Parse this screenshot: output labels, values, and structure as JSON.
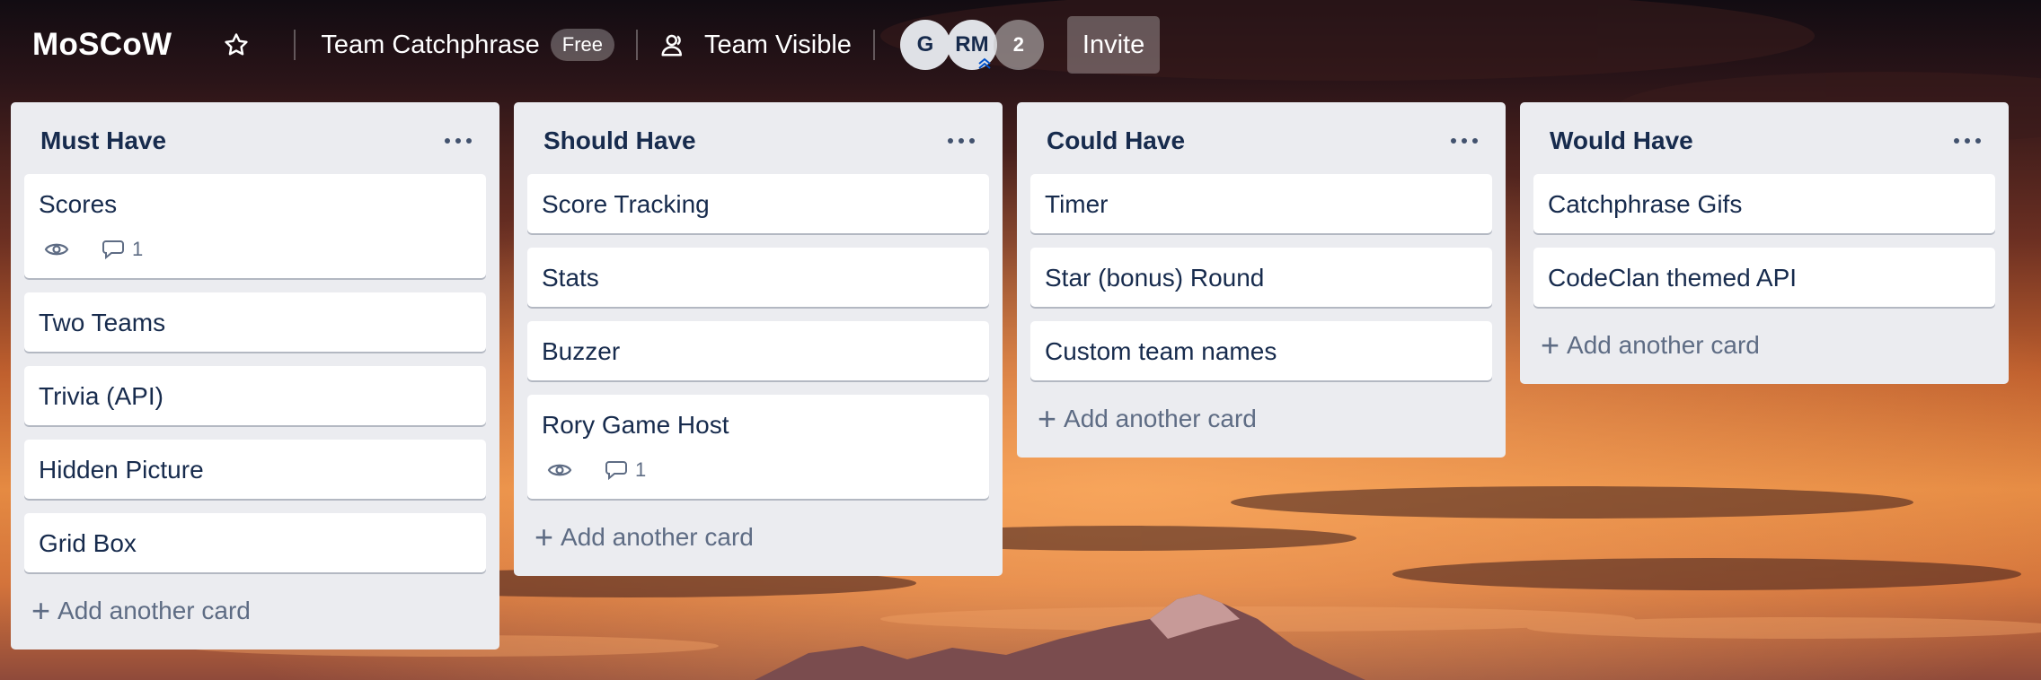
{
  "board": {
    "title": "MoSCoW",
    "team_name": "Team Catchphrase",
    "plan_badge": "Free",
    "visibility": "Team Visible",
    "members": [
      "G",
      "RM"
    ],
    "extra_members": "2",
    "invite_label": "Invite"
  },
  "lists": [
    {
      "title": "Must Have",
      "cards": [
        {
          "title": "Scores",
          "watch": true,
          "comments": "1"
        },
        {
          "title": "Two Teams"
        },
        {
          "title": "Trivia (API)"
        },
        {
          "title": "Hidden Picture"
        },
        {
          "title": "Grid Box"
        }
      ],
      "add_label": "Add another card"
    },
    {
      "title": "Should Have",
      "cards": [
        {
          "title": "Score Tracking"
        },
        {
          "title": "Stats"
        },
        {
          "title": "Buzzer"
        },
        {
          "title": "Rory Game Host",
          "watch": true,
          "comments": "1"
        }
      ],
      "add_label": "Add another card"
    },
    {
      "title": "Could Have",
      "cards": [
        {
          "title": "Timer"
        },
        {
          "title": "Star (bonus) Round"
        },
        {
          "title": "Custom team names"
        }
      ],
      "add_label": "Add another card"
    },
    {
      "title": "Would Have",
      "cards": [
        {
          "title": "Catchphrase Gifs"
        },
        {
          "title": "CodeClan themed API"
        }
      ],
      "add_label": "Add another card"
    }
  ],
  "icons": {
    "star": "star-icon",
    "visibility": "team-visible-icon",
    "watch": "eye-icon",
    "comment": "comment-icon",
    "list_menu": "more-icon",
    "add": "plus-icon"
  },
  "colors": {
    "list_bg": "#ebecf0",
    "card_bg": "#ffffff",
    "text": "#172b4d",
    "muted": "#5e6c84"
  }
}
